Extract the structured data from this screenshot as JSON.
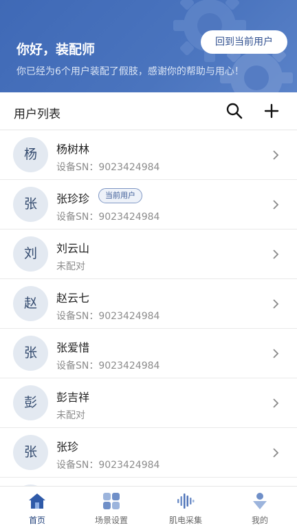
{
  "header": {
    "greeting": "你好，装配师",
    "subtitle": "你已经为6个用户装配了假肢，感谢你的帮助与用心！",
    "back_button": "回到当前用户"
  },
  "list_header": {
    "title": "用户列表",
    "search_icon": "search-icon",
    "add_icon": "plus-icon"
  },
  "users": [
    {
      "avatar": "杨",
      "name": "杨树林",
      "status": "设备SN：9023424984",
      "badge": ""
    },
    {
      "avatar": "张",
      "name": "张珍珍",
      "status": "设备SN：9023424984",
      "badge": "当前用户"
    },
    {
      "avatar": "刘",
      "name": "刘云山",
      "status": "未配对",
      "badge": ""
    },
    {
      "avatar": "赵",
      "name": "赵云七",
      "status": "设备SN：9023424984",
      "badge": ""
    },
    {
      "avatar": "张",
      "name": "张爱惜",
      "status": "设备SN：9023424984",
      "badge": ""
    },
    {
      "avatar": "彭",
      "name": "彭吉祥",
      "status": "未配对",
      "badge": ""
    },
    {
      "avatar": "张",
      "name": "张珍",
      "status": "设备SN：9023424984",
      "badge": ""
    },
    {
      "avatar": "",
      "name": "",
      "status": "",
      "badge": ""
    }
  ],
  "tabs": [
    {
      "label": "首页",
      "icon": "home-icon",
      "active": true
    },
    {
      "label": "场景设置",
      "icon": "grid-icon",
      "active": false
    },
    {
      "label": "肌电采集",
      "icon": "waveform-icon",
      "active": false
    },
    {
      "label": "我的",
      "icon": "person-icon",
      "active": false
    }
  ],
  "colors": {
    "header_bg": "#4a74be",
    "accent": "#3d5c97",
    "avatar_bg": "#e3e9f1"
  }
}
